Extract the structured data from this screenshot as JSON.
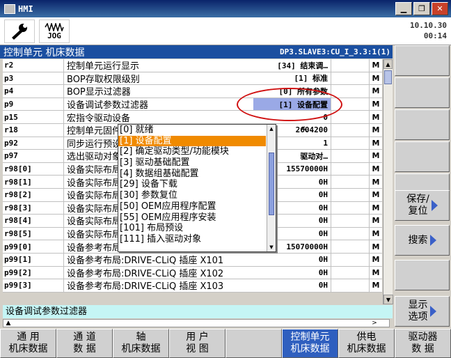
{
  "window": {
    "title": "HMI"
  },
  "toolbar": {
    "jog_label": "JOG",
    "date": "10.10.30",
    "time": "00:14"
  },
  "header": {
    "title": "控制单元 机床数据",
    "drive_object": "DP3.SLAVE3:CU_I_3.3:1(1)"
  },
  "rows": [
    {
      "id": "r2",
      "desc": "控制单元运行显示",
      "value": "[34] 结束调…",
      "unit": "",
      "flag": "M"
    },
    {
      "id": "p3",
      "desc": "BOP存取权限级别",
      "value": "[1] 标准",
      "unit": "",
      "flag": "M"
    },
    {
      "id": "p4",
      "desc": "BOP显示过滤器",
      "value": "[0] 所有参数",
      "unit": "",
      "flag": "M"
    },
    {
      "id": "p9",
      "desc": "设备调试参数过滤器",
      "value": "[1] 设备配置",
      "unit": "",
      "flag": "M"
    },
    {
      "id": "p15",
      "desc": "宏指令驱动设备",
      "value": "0",
      "unit": "",
      "flag": "M"
    },
    {
      "id": "r18",
      "desc": "控制单元固件版本",
      "value": "2604200",
      "unit": "",
      "flag": "M"
    },
    {
      "id": "p92",
      "desc": "同步运行预设",
      "value": "1",
      "unit": "",
      "flag": "M"
    },
    {
      "id": "p97",
      "desc": "选出驱动对象类型",
      "value": "驱动对…",
      "unit": "",
      "flag": "M"
    },
    {
      "id": "r98[0]",
      "desc": "设备实际布局",
      "value": "15570000H",
      "unit": "",
      "flag": "M"
    },
    {
      "id": "r98[1]",
      "desc": "设备实际布局",
      "value": "0H",
      "unit": "",
      "flag": "M"
    },
    {
      "id": "r98[2]",
      "desc": "设备实际布局",
      "value": "0H",
      "unit": "",
      "flag": "M"
    },
    {
      "id": "r98[3]",
      "desc": "设备实际布局",
      "value": "0H",
      "unit": "",
      "flag": "M"
    },
    {
      "id": "r98[4]",
      "desc": "设备实际布局",
      "value": "0H",
      "unit": "",
      "flag": "M"
    },
    {
      "id": "r98[5]",
      "desc": "设备实际布局",
      "value": "0H",
      "unit": "",
      "flag": "M"
    },
    {
      "id": "p99[0]",
      "desc": "设备参考布局:DRIVE-CLiQ 插座 X100",
      "value": "15070000H",
      "unit": "",
      "flag": "M"
    },
    {
      "id": "p99[1]",
      "desc": "设备参考布局:DRIVE-CLiQ 插座 X101",
      "value": "0H",
      "unit": "",
      "flag": "M"
    },
    {
      "id": "p99[2]",
      "desc": "设备参考布局:DRIVE-CLiQ 插座 X102",
      "value": "0H",
      "unit": "",
      "flag": "M"
    },
    {
      "id": "p99[3]",
      "desc": "设备参考布局:DRIVE-CLiQ 插座 X103",
      "value": "0H",
      "unit": "",
      "flag": "M"
    }
  ],
  "dropdown": {
    "options": [
      "[0] 就绪",
      "[1] 设备配置",
      "[2] 确定驱动类型/功能模块",
      "[3] 驱动基础配置",
      "[4] 数据组基础配置",
      "[29] 设备下载",
      "[30] 参数复位",
      "[50] OEM应用程序配置",
      "[55] OEM应用程序安装",
      "[101] 布局预设",
      "[111] 插入驱动对象"
    ],
    "selected_index": 1
  },
  "status": {
    "text": "设备调试参数过滤器"
  },
  "softkeys": {
    "save_reset": "保存/\n复位",
    "search": "搜索",
    "display_options": "显示\n选项"
  },
  "hkeys": [
    "通  用\n机床数据",
    "通 道\n数 据",
    "轴\n机床数据",
    "用 户\n视 图",
    "",
    "控制单元\n机床数据",
    "供电\n机床数据",
    "驱动器\n数  据"
  ],
  "hkeys_active_index": 5
}
